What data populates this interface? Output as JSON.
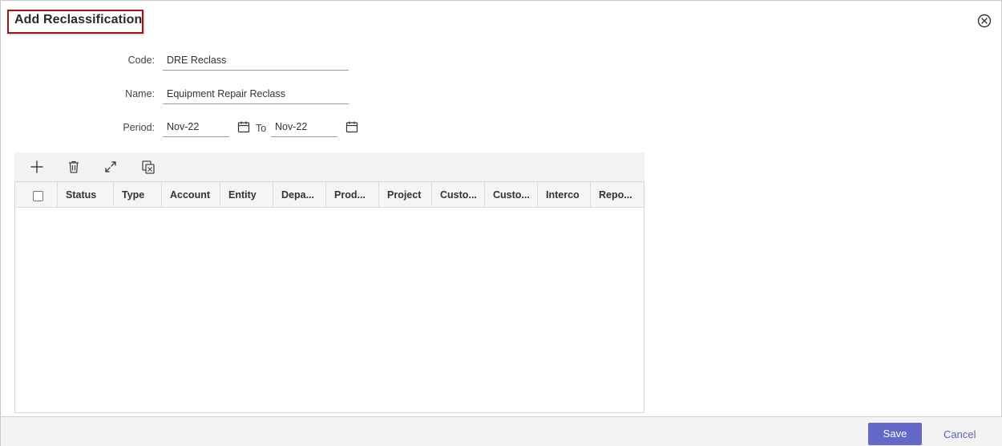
{
  "dialog": {
    "title": "Add Reclassification"
  },
  "form": {
    "code": {
      "label": "Code:",
      "value": "DRE Reclass"
    },
    "name": {
      "label": "Name:",
      "value": "Equipment Repair Reclass"
    },
    "period": {
      "label": "Period:",
      "from": "Nov-22",
      "to_label": "To",
      "to": "Nov-22"
    }
  },
  "toolbar": {
    "icons": [
      "add-icon",
      "delete-icon",
      "expand-icon",
      "copy-icon"
    ]
  },
  "grid": {
    "columns": [
      "Status",
      "Type",
      "Account",
      "Entity",
      "Depa...",
      "Prod...",
      "Project",
      "Custo...",
      "Custo...",
      "Interco",
      "Repo..."
    ],
    "rows": []
  },
  "footer": {
    "save_label": "Save",
    "cancel_label": "Cancel"
  },
  "colors": {
    "accent": "#6368c9",
    "title_border": "#a31515",
    "link": "#5a60c4"
  }
}
